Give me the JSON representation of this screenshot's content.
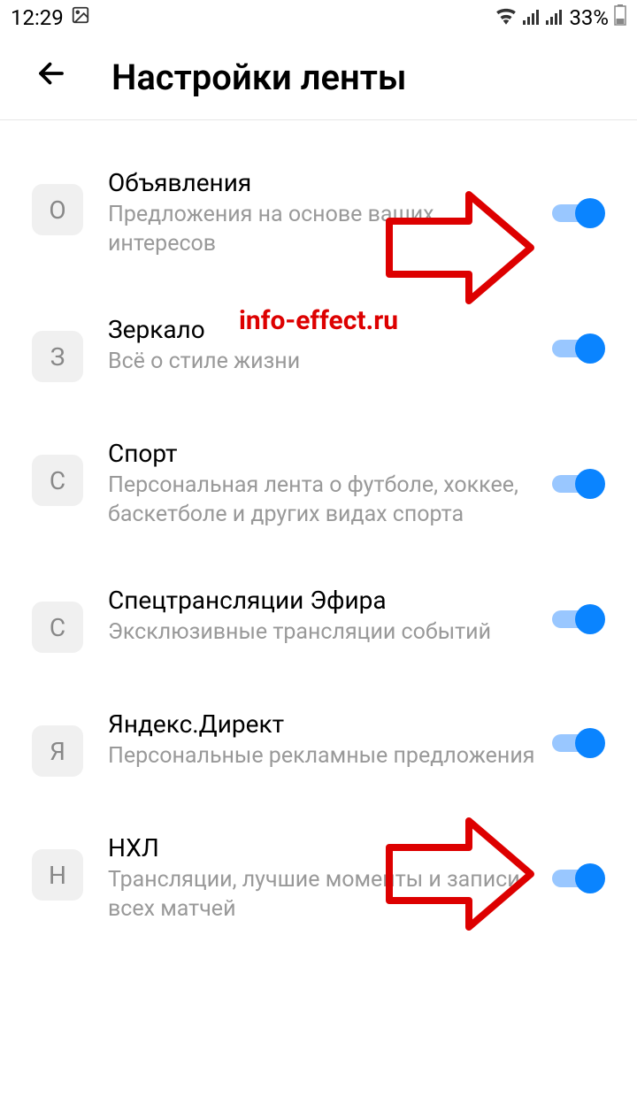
{
  "statusBar": {
    "time": "12:29",
    "battery": "33%"
  },
  "header": {
    "title": "Настройки ленты"
  },
  "watermark": "info-effect.ru",
  "feedItems": [
    {
      "letter": "О",
      "title": "Объявления",
      "subtitle": "Предложения на основе ваших интересов",
      "enabled": true
    },
    {
      "letter": "З",
      "title": "Зеркало",
      "subtitle": "Всё о стиле жизни",
      "enabled": true
    },
    {
      "letter": "С",
      "title": "Спорт",
      "subtitle": "Персональная лента о футболе, хоккее, баскетболе и других видах спорта",
      "enabled": true
    },
    {
      "letter": "С",
      "title": "Спецтрансляции Эфира",
      "subtitle": "Эксклюзивные трансляции событий",
      "enabled": true
    },
    {
      "letter": "Я",
      "title": "Яндекс.Директ",
      "subtitle": "Персональные рекламные предложения",
      "enabled": true
    },
    {
      "letter": "Н",
      "title": "НХЛ",
      "subtitle": "Трансляции, лучшие моменты и записи всех матчей",
      "enabled": true
    }
  ]
}
